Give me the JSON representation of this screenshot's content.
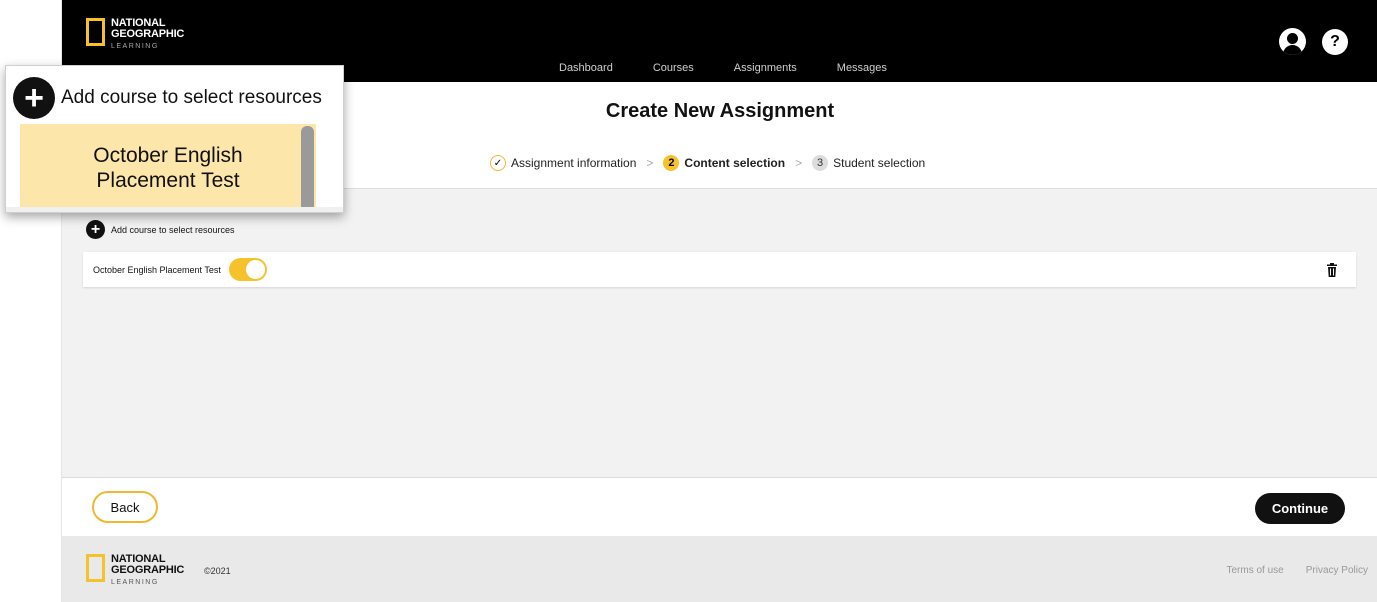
{
  "brand": {
    "line1": "NATIONAL",
    "line2": "GEOGRAPHIC",
    "line3": "LEARNING",
    "accent_color": "#f6c22c"
  },
  "nav": {
    "items": [
      "Dashboard",
      "Courses",
      "Assignments",
      "Messages"
    ]
  },
  "header": {
    "help_label": "?",
    "title": "Create New Assignment"
  },
  "steps": [
    {
      "marker": "✓",
      "label": "Assignment information",
      "state": "done"
    },
    {
      "marker": "2",
      "label": "Content selection",
      "state": "active"
    },
    {
      "marker": "3",
      "label": "Student selection",
      "state": "pending"
    }
  ],
  "step_separator": ">",
  "content": {
    "add_course_label": "Add course to select resources",
    "courses": [
      {
        "name": "October English Placement Test",
        "enabled": true
      }
    ]
  },
  "actions": {
    "back_label": "Back",
    "continue_label": "Continue"
  },
  "footer": {
    "copyright": "©2021",
    "links": [
      "Terms of use",
      "Privacy Policy"
    ]
  },
  "zoom_callout": {
    "add_course_label": "Add course to select resources",
    "course_name_line1": "October English",
    "course_name_line2": "Placement Test"
  }
}
